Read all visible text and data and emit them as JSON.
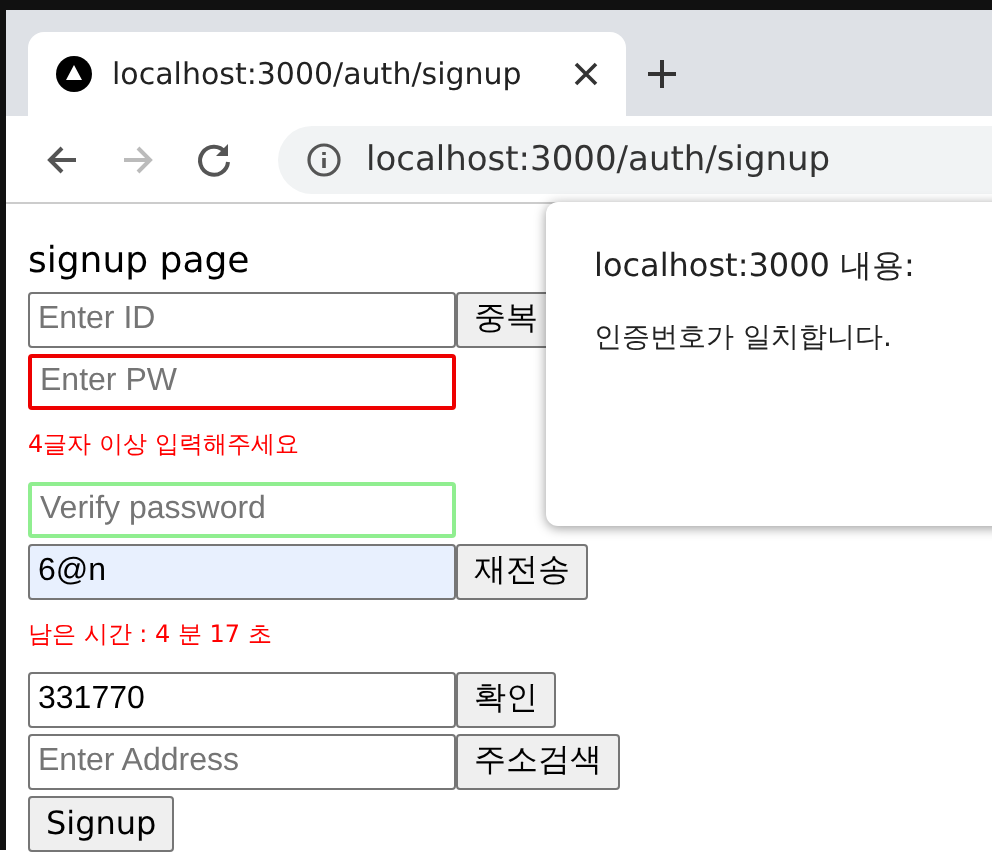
{
  "browser": {
    "tab": {
      "title": "localhost:3000/auth/signup"
    },
    "address": "localhost:3000/auth/signup",
    "forward_disabled": true
  },
  "page": {
    "heading": "signup page",
    "rows": [
      {
        "kind": "field",
        "field": {
          "placeholder": "Enter ID",
          "invalid": false,
          "valid": false
        },
        "button": "중복"
      },
      {
        "kind": "field",
        "field": {
          "placeholder": "Enter PW",
          "invalid": true,
          "valid": false
        }
      },
      {
        "kind": "message",
        "text": "4글자 이상 입력해주세요"
      },
      {
        "kind": "field",
        "field": {
          "placeholder": "Verify password",
          "invalid": false,
          "valid": true
        }
      },
      {
        "kind": "field",
        "field": {
          "value": "6@n",
          "invalid": false,
          "valid": false,
          "autofilled": true
        },
        "button": "재전송"
      },
      {
        "kind": "message",
        "text": "남은 시간 : 4 분 17 초"
      },
      {
        "kind": "field",
        "field": {
          "value": "331770",
          "invalid": false,
          "valid": false
        },
        "button": "확인"
      },
      {
        "kind": "field",
        "field": {
          "placeholder": "Enter Address",
          "invalid": false,
          "valid": false
        },
        "button": "주소검색"
      },
      {
        "kind": "button",
        "button": "Signup"
      }
    ]
  },
  "dialog": {
    "title": "localhost:3000 내용:",
    "message": "인증번호가 일치합니다."
  }
}
